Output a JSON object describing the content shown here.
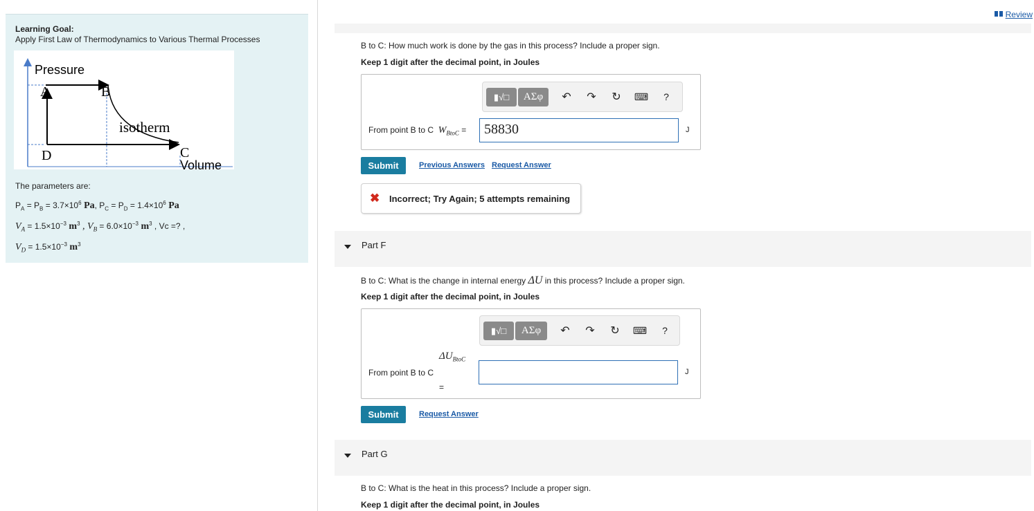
{
  "review": {
    "label": "Review"
  },
  "learning_goal": {
    "title": "Learning Goal:",
    "text": "Apply First Law of Thermodynamics to Various Thermal Processes"
  },
  "diagram": {
    "y_axis_label": "Pressure",
    "x_axis_label": "Volume",
    "point_a": "A",
    "point_b": "B",
    "point_c": "C",
    "point_d": "D",
    "curve_label": "isotherm"
  },
  "params": {
    "title": "The parameters are:",
    "pa": "P",
    "pa_sub": "A",
    "eq1": " = P",
    "pb_sub": "B",
    "val1": " = 3.7×10",
    "exp1": "6",
    "unit1": " Pa",
    "pc": ",  P",
    "pc_sub": "C",
    "eq2": " = P",
    "pd_sub": "D",
    "val2": " = 1.4×10",
    "exp2": "6",
    "unit2": " Pa",
    "va": "V",
    "va_sub": "A",
    "val3": " = 1.5×10",
    "exp3": "−3",
    "unit3": " m",
    "exp3b": "3",
    "vb": " ,  V",
    "vb_sub": "B",
    "val4": " = 6.0×10",
    "exp4": "−3",
    "unit4": " m",
    "exp4b": "3",
    "vc": " ,  Vc =?  ,",
    "vd": "V",
    "vd_sub": "D",
    "val5": " = 1.5×10",
    "exp5": "−3",
    "unit5": " m",
    "exp5b": "3"
  },
  "part_e": {
    "question": "B to C: How much work is done by the gas in this process? Include a proper sign.",
    "instruction": "Keep 1 digit after the decimal point, in Joules",
    "prefix": "From point B to C",
    "var": "W",
    "var_sub": "BtoC",
    "eq": " =",
    "value": "58830",
    "unit": "J",
    "submit": "Submit",
    "prev_answers": "Previous Answers",
    "request_answer": "Request Answer",
    "feedback": "Incorrect; Try Again; 5 attempts remaining"
  },
  "toolbar": {
    "templates": "▮√□",
    "greek": "ΑΣφ",
    "undo": "↶",
    "redo": "↷",
    "reset": "↻",
    "keyboard": "⌨",
    "help": "?"
  },
  "part_f": {
    "label": "Part F",
    "question_pre": "B to C: What is the change in internal energy ",
    "question_var": "ΔU",
    "question_post": " in this process? Include a proper sign.",
    "instruction": "Keep 1 digit after the decimal point, in Joules",
    "prefix": "From point B to C",
    "var": "ΔU",
    "var_sub": "BtoC",
    "eq": "=",
    "value": "",
    "unit": "J",
    "submit": "Submit",
    "request_answer": "Request Answer"
  },
  "part_g": {
    "label": "Part G",
    "question": "B to C: What is the heat in this process? Include a proper sign.",
    "instruction": "Keep 1 digit after the decimal point, in Joules"
  }
}
